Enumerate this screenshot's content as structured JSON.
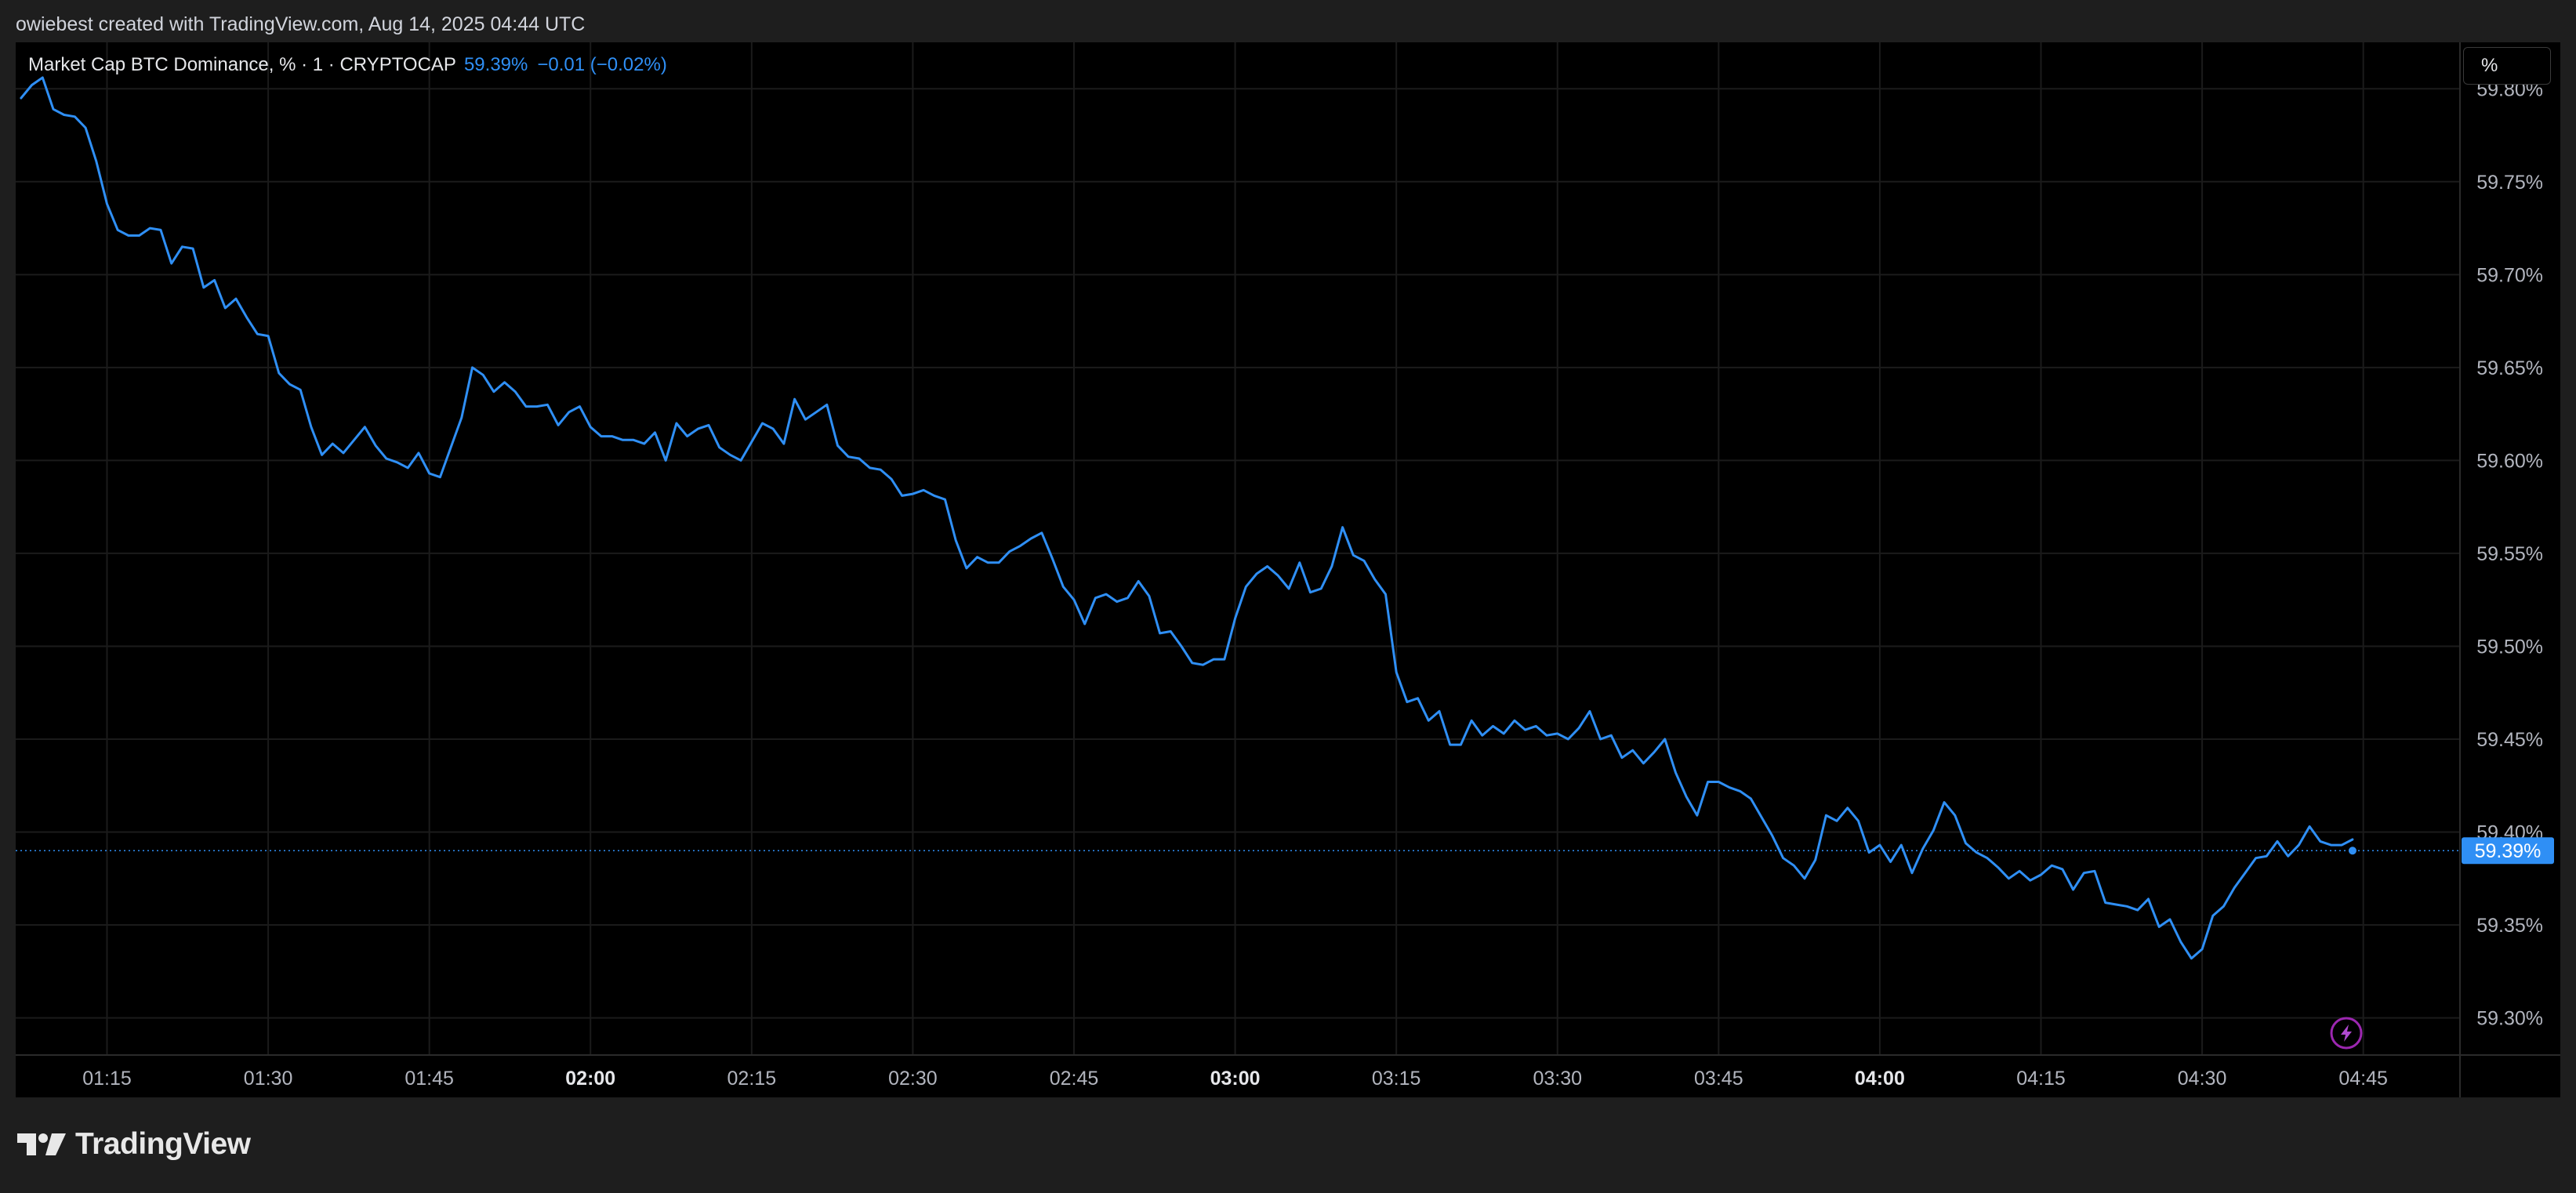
{
  "header": {
    "caption": "owiebest created with TradingView.com, Aug 14, 2025 04:44 UTC"
  },
  "legend": {
    "symbol": "Market Cap BTC Dominance, % · 1 · CRYPTOCAP",
    "last": "59.39%",
    "change": "−0.01 (−0.02%)"
  },
  "unit_button": {
    "label": "%"
  },
  "price_tag": {
    "label": "59.39%"
  },
  "brand": {
    "name": "TradingView",
    "logo_icon": "tradingview-logo-icon"
  },
  "alert_icon": "lightning-icon",
  "colors": {
    "line": "#2f8ff5",
    "background": "#000000",
    "frame": "#1e1e1e",
    "grid": "#1b1b1b",
    "price_tag": "#2f8ff5",
    "alert": "#9c27b0"
  },
  "chart_data": {
    "type": "line",
    "title": "Market Cap BTC Dominance, % · 1 · CRYPTOCAP",
    "xlabel": "",
    "ylabel": "",
    "x_ticks": [
      {
        "label": "01:15",
        "minutes": 75,
        "bold": false
      },
      {
        "label": "01:30",
        "minutes": 90,
        "bold": false
      },
      {
        "label": "01:45",
        "minutes": 105,
        "bold": false
      },
      {
        "label": "02:00",
        "minutes": 120,
        "bold": true
      },
      {
        "label": "02:15",
        "minutes": 135,
        "bold": false
      },
      {
        "label": "02:30",
        "minutes": 150,
        "bold": false
      },
      {
        "label": "02:45",
        "minutes": 165,
        "bold": false
      },
      {
        "label": "03:00",
        "minutes": 180,
        "bold": true
      },
      {
        "label": "03:15",
        "minutes": 195,
        "bold": false
      },
      {
        "label": "03:30",
        "minutes": 210,
        "bold": false
      },
      {
        "label": "03:45",
        "minutes": 225,
        "bold": false
      },
      {
        "label": "04:00",
        "minutes": 240,
        "bold": true
      },
      {
        "label": "04:15",
        "minutes": 255,
        "bold": false
      },
      {
        "label": "04:30",
        "minutes": 270,
        "bold": false
      },
      {
        "label": "04:45",
        "minutes": 285,
        "bold": false
      }
    ],
    "y_ticks": [
      "59.30%",
      "59.35%",
      "59.40%",
      "59.45%",
      "59.50%",
      "59.55%",
      "59.60%",
      "59.65%",
      "59.70%",
      "59.75%",
      "59.80%"
    ],
    "ylim": [
      59.28,
      59.825
    ],
    "xlim": [
      66.5,
      294
    ],
    "grid": true,
    "last_value": 59.39,
    "series": [
      {
        "minutes": [
          67,
          68,
          69,
          70,
          71,
          72,
          73,
          74,
          75,
          76,
          77,
          78,
          79,
          80,
          81,
          82,
          83,
          84,
          85,
          86,
          87,
          88,
          89,
          90,
          91,
          92,
          93,
          94,
          95,
          96,
          97,
          98,
          99,
          100,
          101,
          102,
          103,
          104,
          105,
          106,
          107,
          108,
          109,
          110,
          111,
          112,
          113,
          114,
          115,
          116,
          117,
          118,
          119,
          120,
          121,
          122,
          123,
          124,
          125,
          126,
          127,
          128,
          129,
          130,
          131,
          132,
          133,
          134,
          135,
          136,
          137,
          138,
          139,
          140,
          141,
          142,
          143,
          144,
          145,
          146,
          147,
          148,
          149,
          150,
          151,
          152,
          153,
          154,
          155,
          156,
          157,
          158,
          159,
          160,
          161,
          162,
          163,
          164,
          165,
          166,
          167,
          168,
          169,
          170,
          171,
          172,
          173,
          174,
          175,
          176,
          177,
          178,
          179,
          180,
          181,
          182,
          183,
          184,
          185,
          186,
          187,
          188,
          189,
          190,
          191,
          192,
          193,
          194,
          195,
          196,
          197,
          198,
          199,
          200,
          201,
          202,
          203,
          204,
          205,
          206,
          207,
          208,
          209,
          210,
          211,
          212,
          213,
          214,
          215,
          216,
          217,
          218,
          219,
          220,
          221,
          222,
          223,
          224,
          225,
          226,
          227,
          228,
          229,
          230,
          231,
          232,
          233,
          234,
          235,
          236,
          237,
          238,
          239,
          240,
          241,
          242,
          243,
          244,
          245,
          246,
          247,
          248,
          249,
          250,
          251,
          252,
          253,
          254,
          255,
          256,
          257,
          258,
          259,
          260,
          261,
          262,
          263,
          264,
          265,
          266,
          267,
          268,
          269,
          270,
          271,
          272,
          273,
          274,
          275,
          276,
          277,
          278,
          279,
          280,
          281,
          282,
          283,
          284
        ],
        "values": [
          59.795,
          59.802,
          59.806,
          59.789,
          59.786,
          59.785,
          59.779,
          59.761,
          59.738,
          59.724,
          59.721,
          59.721,
          59.725,
          59.724,
          59.706,
          59.715,
          59.714,
          59.693,
          59.697,
          59.682,
          59.687,
          59.677,
          59.668,
          59.667,
          59.647,
          59.641,
          59.638,
          59.618,
          59.603,
          59.609,
          59.604,
          59.611,
          59.618,
          59.608,
          59.601,
          59.599,
          59.596,
          59.604,
          59.593,
          59.591,
          59.607,
          59.623,
          59.65,
          59.646,
          59.637,
          59.642,
          59.637,
          59.629,
          59.629,
          59.63,
          59.619,
          59.626,
          59.629,
          59.618,
          59.613,
          59.613,
          59.611,
          59.611,
          59.609,
          59.615,
          59.6,
          59.62,
          59.613,
          59.617,
          59.619,
          59.607,
          59.603,
          59.6,
          59.61,
          59.62,
          59.617,
          59.609,
          59.633,
          59.622,
          59.626,
          59.63,
          59.608,
          59.602,
          59.601,
          59.596,
          59.595,
          59.59,
          59.581,
          59.582,
          59.584,
          59.581,
          59.579,
          59.557,
          59.542,
          59.548,
          59.545,
          59.545,
          59.551,
          59.554,
          59.558,
          59.561,
          59.547,
          59.532,
          59.525,
          59.512,
          59.526,
          59.528,
          59.524,
          59.526,
          59.535,
          59.527,
          59.507,
          59.508,
          59.5,
          59.491,
          59.49,
          59.493,
          59.493,
          59.515,
          59.532,
          59.539,
          59.543,
          59.538,
          59.531,
          59.545,
          59.529,
          59.531,
          59.543,
          59.564,
          59.549,
          59.546,
          59.536,
          59.528,
          59.486,
          59.47,
          59.472,
          59.46,
          59.465,
          59.447,
          59.447,
          59.46,
          59.452,
          59.457,
          59.453,
          59.46,
          59.455,
          59.457,
          59.452,
          59.453,
          59.45,
          59.456,
          59.465,
          59.45,
          59.452,
          59.44,
          59.444,
          59.437,
          59.443,
          59.45,
          59.432,
          59.419,
          59.409,
          59.427,
          59.427,
          59.424,
          59.422,
          59.418,
          59.408,
          59.398,
          59.386,
          59.382,
          59.375,
          59.385,
          59.409,
          59.406,
          59.413,
          59.406,
          59.389,
          59.393,
          59.384,
          59.393,
          59.378,
          59.391,
          59.401,
          59.416,
          59.409,
          59.394,
          59.389,
          59.386,
          59.381,
          59.375,
          59.379,
          59.374,
          59.377,
          59.382,
          59.38,
          59.369,
          59.378,
          59.379,
          59.362,
          59.361,
          59.36,
          59.358,
          59.364,
          59.349,
          59.353,
          59.341,
          59.332,
          59.337,
          59.355,
          59.36,
          59.37,
          59.378,
          59.386,
          59.387,
          59.395,
          59.387,
          59.393,
          59.403,
          59.395,
          59.393,
          59.393,
          59.396,
          59.401,
          59.404,
          59.39
        ]
      }
    ]
  }
}
